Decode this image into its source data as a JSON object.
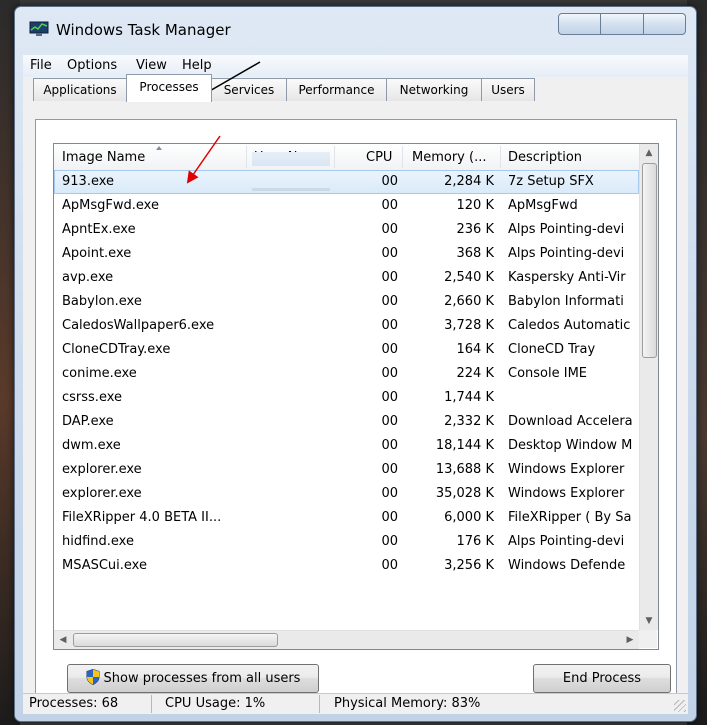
{
  "window": {
    "title": "Windows Task Manager"
  },
  "menu": [
    "File",
    "Options",
    "View",
    "Help"
  ],
  "tabs": [
    "Applications",
    "Processes",
    "Services",
    "Performance",
    "Networking",
    "Users"
  ],
  "active_tab": "Processes",
  "columns": {
    "image_name": "Image Name",
    "user_name": "User Name",
    "cpu": "CPU",
    "memory": "Memory (...",
    "description": "Description"
  },
  "processes": [
    {
      "name": "913.exe",
      "user": "",
      "cpu": "00",
      "memory": "2,284 K",
      "description": "7z Setup SFX"
    },
    {
      "name": "ApMsgFwd.exe",
      "user": "",
      "cpu": "00",
      "memory": "120 K",
      "description": "ApMsgFwd"
    },
    {
      "name": "ApntEx.exe",
      "user": "",
      "cpu": "00",
      "memory": "236 K",
      "description": "Alps Pointing-devi"
    },
    {
      "name": "Apoint.exe",
      "user": "",
      "cpu": "00",
      "memory": "368 K",
      "description": "Alps Pointing-devi"
    },
    {
      "name": "avp.exe",
      "user": "",
      "cpu": "00",
      "memory": "2,540 K",
      "description": "Kaspersky Anti-Vir"
    },
    {
      "name": "Babylon.exe",
      "user": "",
      "cpu": "00",
      "memory": "2,660 K",
      "description": "Babylon Informati"
    },
    {
      "name": "CaledosWallpaper6.exe",
      "user": "",
      "cpu": "00",
      "memory": "3,728 K",
      "description": "Caledos Automatic"
    },
    {
      "name": "CloneCDTray.exe",
      "user": "",
      "cpu": "00",
      "memory": "164 K",
      "description": "CloneCD Tray"
    },
    {
      "name": "conime.exe",
      "user": "",
      "cpu": "00",
      "memory": "224 K",
      "description": "Console IME"
    },
    {
      "name": "csrss.exe",
      "user": "",
      "cpu": "00",
      "memory": "1,744 K",
      "description": ""
    },
    {
      "name": "DAP.exe",
      "user": "",
      "cpu": "00",
      "memory": "2,332 K",
      "description": "Download Accelera"
    },
    {
      "name": "dwm.exe",
      "user": "",
      "cpu": "00",
      "memory": "18,144 K",
      "description": "Desktop Window M"
    },
    {
      "name": "explorer.exe",
      "user": "",
      "cpu": "00",
      "memory": "13,688 K",
      "description": "Windows Explorer"
    },
    {
      "name": "explorer.exe",
      "user": "",
      "cpu": "00",
      "memory": "35,028 K",
      "description": "Windows Explorer"
    },
    {
      "name": "FileXRipper 4.0 BETA II...",
      "user": "",
      "cpu": "00",
      "memory": "6,000 K",
      "description": "FileXRipper ( By Sa"
    },
    {
      "name": "hidfind.exe",
      "user": "",
      "cpu": "00",
      "memory": "176 K",
      "description": "Alps Pointing-devi"
    },
    {
      "name": "MSASCui.exe",
      "user": "",
      "cpu": "00",
      "memory": "3,256 K",
      "description": "Windows Defende"
    }
  ],
  "selected_process": "913.exe",
  "buttons": {
    "show_all": "Show processes from all users",
    "end_process": "End Process"
  },
  "status": {
    "processes": "Processes: 68",
    "cpu_usage": "CPU Usage: 1%",
    "physical_memory": "Physical Memory: 83%"
  },
  "colors": {
    "selection": "#d9eaf9",
    "annotation_black": "#000000",
    "annotation_red": "#e00000"
  }
}
